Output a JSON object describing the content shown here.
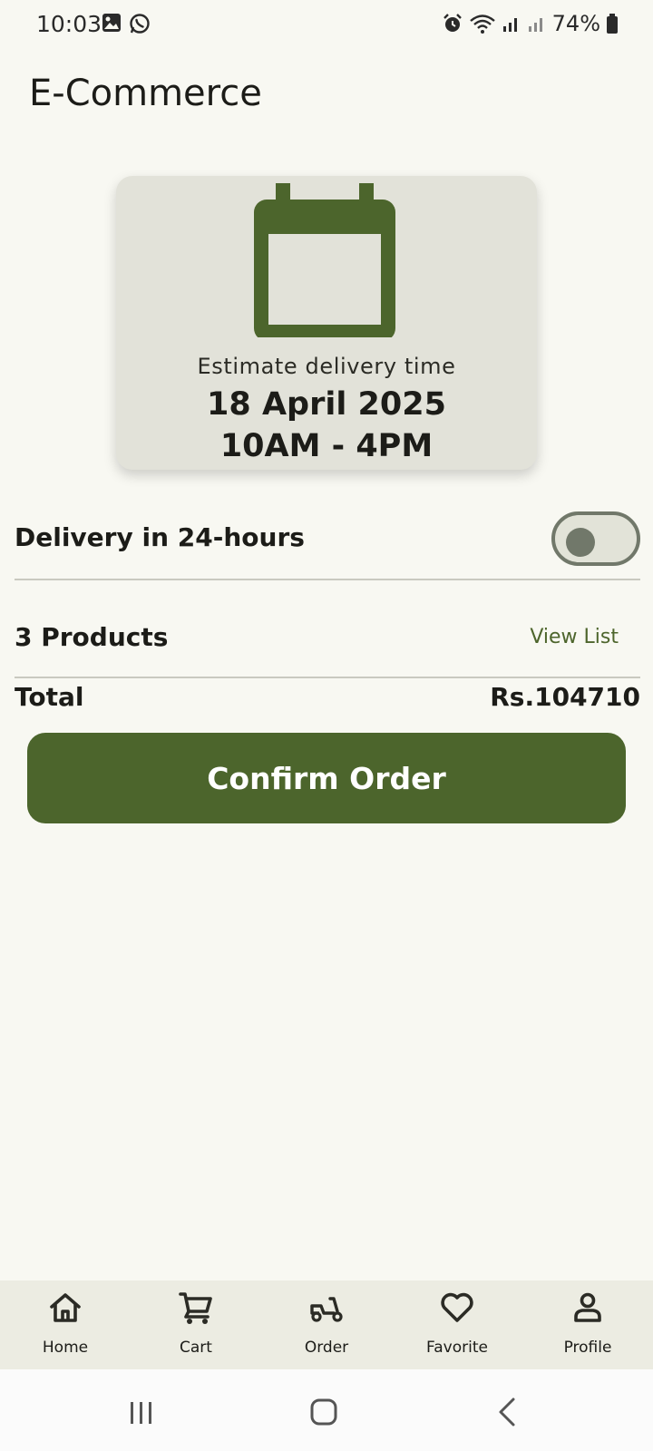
{
  "status_bar": {
    "time": "10:03",
    "battery": "74%",
    "left_icons": [
      "gallery-icon",
      "whatsapp-icon"
    ],
    "right_icons": [
      "alarm-icon",
      "wifi-icon",
      "signal-icon",
      "signal-icon-2",
      "battery-icon"
    ]
  },
  "app": {
    "title": "E-Commerce"
  },
  "delivery_card": {
    "icon": "calendar-icon",
    "label": "Estimate delivery time",
    "date": "18 April 2025",
    "window": "10AM - 4PM"
  },
  "delivery_option": {
    "label": "Delivery in 24-hours",
    "enabled": false
  },
  "products": {
    "label": "3 Products",
    "action": "View List"
  },
  "total": {
    "label": "Total",
    "amount": "Rs.104710"
  },
  "confirm_button": {
    "label": "Confirm Order"
  },
  "bottom_nav": {
    "items": [
      {
        "label": "Home",
        "icon": "home-icon"
      },
      {
        "label": "Cart",
        "icon": "cart-icon"
      },
      {
        "label": "Order",
        "icon": "scooter-icon"
      },
      {
        "label": "Favorite",
        "icon": "heart-icon"
      },
      {
        "label": "Profile",
        "icon": "profile-icon"
      }
    ]
  },
  "colors": {
    "accent": "#4c652c",
    "background": "#f8f8f2",
    "card": "#e2e2d9",
    "nav_background": "#ecece2"
  }
}
